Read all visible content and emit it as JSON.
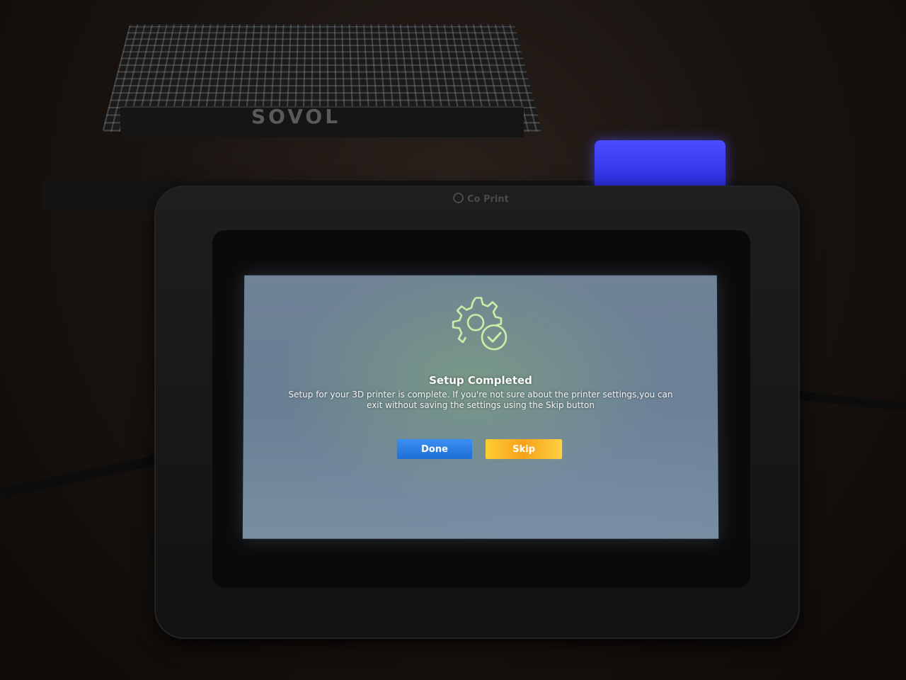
{
  "background": {
    "bed_brand": "SOVOL"
  },
  "device": {
    "brand": "Co Print"
  },
  "dialog": {
    "icon": "gear-check-icon",
    "title": "Setup Completed",
    "message": "Setup for your 3D printer is complete. If you're not sure about the printer settings,you can exit without saving the settings using the Skip button",
    "done_label": "Done",
    "skip_label": "Skip"
  },
  "colors": {
    "done_button": "#2b7fe6",
    "skip_button": "#f7b52a",
    "icon_stroke": "#c8f0a8"
  }
}
